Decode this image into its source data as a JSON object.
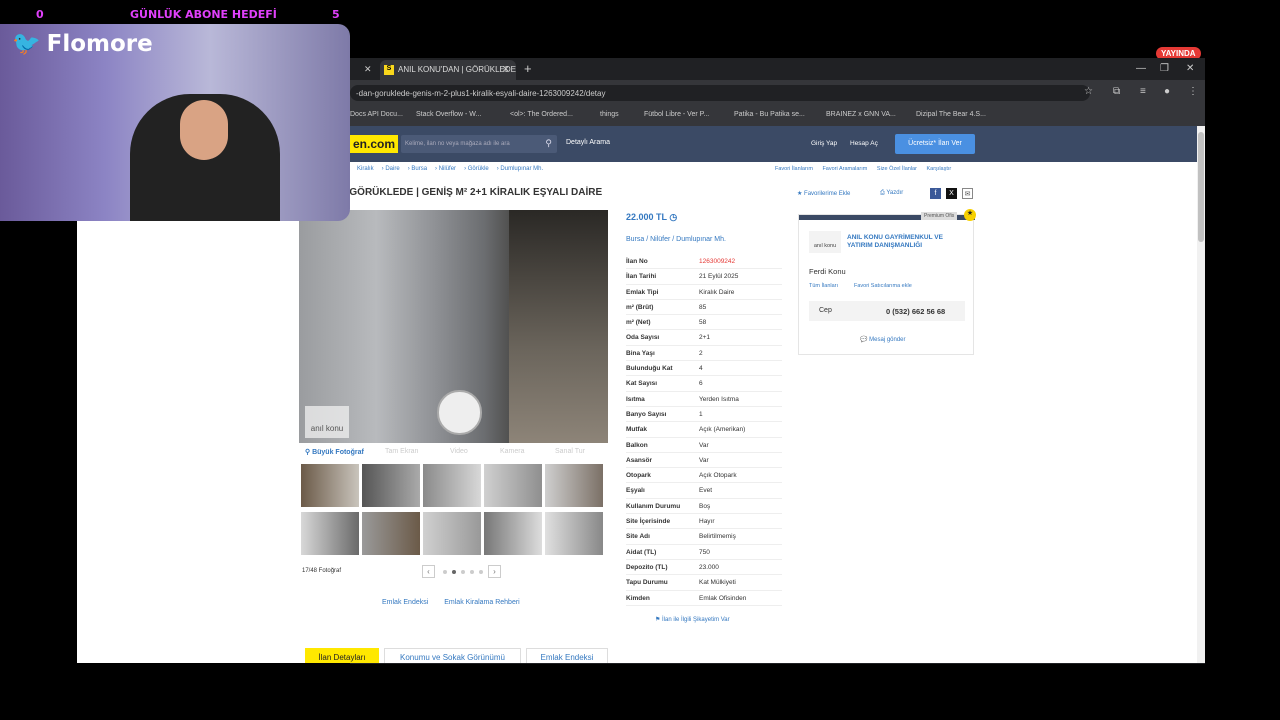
{
  "stream": {
    "left_counter": "0",
    "goal_label": "GÜNLÜK ABONE HEDEFİ",
    "right_counter": "5",
    "live_badge": "YAYINDA",
    "cam_name": "Flomore"
  },
  "browser": {
    "tab_title": "ANIL KONU'DAN | GÖRÜKLEDE |",
    "tab_favicon": "S",
    "url": "-dan-goruklede-genis-m-2-plus1-kiralik-esyali-daire-1263009242/detay",
    "bookmarks": [
      "Docs API Docu...",
      "Stack Overflow - W...",
      "<ol>: The Ordered...",
      "things",
      "Fütbol Libre - Ver P...",
      "Patika - Bu Patika se...",
      "BRAINEZ x GNN VA...",
      "Dizipal The Bear 4.S..."
    ]
  },
  "site": {
    "logo": "en.com",
    "search_placeholder": "Kelime, ilan no veya mağaza adı ile ara",
    "detailed_search": "Detaylı Arama",
    "login": "Giriş Yap",
    "register": "Hesap Aç",
    "post_button": "Ücretsiz* İlan Ver",
    "breadcrumbs": [
      "Kiralık",
      "Daire",
      "Bursa",
      "Nilüfer",
      "Görükle",
      "Dumlupınar Mh."
    ],
    "right_links": [
      "Favori İlanlarım",
      "Favori Aramalarım",
      "Size Özel İlanlar",
      "Karşılaştır"
    ],
    "title": "'DAN | GÖRÜKLEDE | GENİŞ M² 2+1 KİRALIK EŞYALI DAİRE",
    "add_fav": "Favorilerime Ekle",
    "print": "Yazdır",
    "photo_brand": "anıl konu",
    "photo_tabs": [
      "Büyük Fotoğraf",
      "Tam Ekran",
      "Video",
      "Kamera",
      "Sanal Tur"
    ],
    "photo_count": "17/48 Fotoğraf",
    "under_links": [
      "Emlak Endeksi",
      "Emlak Kiralama Rehberi"
    ],
    "price": "22.000 TL",
    "location": "Bursa  /  Nilüfer  /  Dumlupınar Mh.",
    "specs": [
      {
        "k": "İlan No",
        "v": "1263009242"
      },
      {
        "k": "İlan Tarihi",
        "v": "21 Eylül 2025"
      },
      {
        "k": "Emlak Tipi",
        "v": "Kiralık Daire"
      },
      {
        "k": "m² (Brüt)",
        "v": "85"
      },
      {
        "k": "m² (Net)",
        "v": "58"
      },
      {
        "k": "Oda Sayısı",
        "v": "2+1"
      },
      {
        "k": "Bina Yaşı",
        "v": "2"
      },
      {
        "k": "Bulunduğu Kat",
        "v": "4"
      },
      {
        "k": "Kat Sayısı",
        "v": "6"
      },
      {
        "k": "Isıtma",
        "v": "Yerden Isıtma"
      },
      {
        "k": "Banyo Sayısı",
        "v": "1"
      },
      {
        "k": "Mutfak",
        "v": "Açık (Amerikan)"
      },
      {
        "k": "Balkon",
        "v": "Var"
      },
      {
        "k": "Asansör",
        "v": "Var"
      },
      {
        "k": "Otopark",
        "v": "Açık Otopark"
      },
      {
        "k": "Eşyalı",
        "v": "Evet"
      },
      {
        "k": "Kullanım Durumu",
        "v": "Boş"
      },
      {
        "k": "Site İçerisinde",
        "v": "Hayır"
      },
      {
        "k": "Site Adı",
        "v": "Belirtilmemiş"
      },
      {
        "k": "Aidat (TL)",
        "v": "750"
      },
      {
        "k": "Depozito (TL)",
        "v": "23.000"
      },
      {
        "k": "Tapu Durumu",
        "v": "Kat Mülkiyeti"
      },
      {
        "k": "Kimden",
        "v": "Emlak Ofisinden"
      }
    ],
    "report": "İlan ile İlgili Şikayetim Var",
    "agent": {
      "premium": "Premium Ofis",
      "logo_text": "anıl konu",
      "name": "ANIL KONU GAYRİMENKUL VE YATIRIM DANIŞMANLIĞI",
      "person": "Ferdi Konu",
      "link_all": "Tüm İlanları",
      "link_fav": "Favori Satıcılarıma ekle",
      "phone_label": "Cep",
      "phone": "0 (532) 662 56 68",
      "message": "Mesaj gönder"
    },
    "bottom_tabs": [
      "İlan Detayları",
      "Konumu ve Sokak Görünümü",
      "Emlak Endeksi"
    ]
  }
}
